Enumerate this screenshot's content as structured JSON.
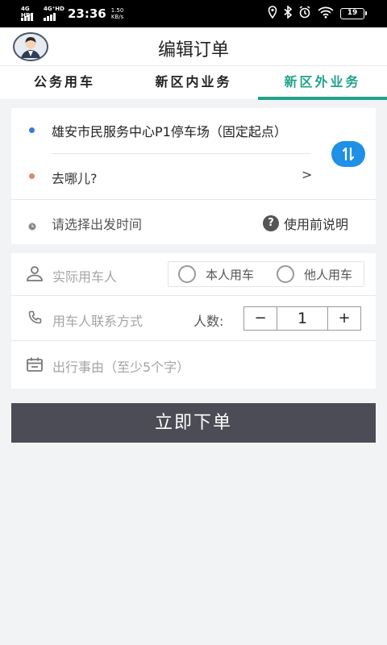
{
  "status_bar": {
    "network1": "4G HD",
    "network2": "4G⁺HD",
    "time": "23:36",
    "speed_value": "1.50",
    "speed_unit": "KB/s",
    "battery": "19"
  },
  "header": {
    "title": "编辑订单"
  },
  "tabs": [
    {
      "label": "公务用车",
      "active": false
    },
    {
      "label": "新区内业务",
      "active": false
    },
    {
      "label": "新区外业务",
      "active": true
    }
  ],
  "route": {
    "origin": "雄安市民服务中心P1停车场（固定起点）",
    "destination_placeholder": "去哪儿?",
    "destination_arrow": ">",
    "departure_time_placeholder": "请选择出发时间",
    "help_label": "使用前说明"
  },
  "passenger": {
    "name_placeholder": "实际用车人",
    "self_option": "本人用车",
    "other_option": "他人用车",
    "contact_placeholder": "用车人联系方式",
    "count_label": "人数:",
    "count_value": "1",
    "minus": "−",
    "plus": "+",
    "reason_placeholder": "出行事由（至少5个字）"
  },
  "submit_label": "立即下单",
  "colors": {
    "accent": "#21a38a",
    "swap_button": "#1e90e6",
    "origin_dot": "#3a78d8",
    "destination_dot": "#e0866a",
    "submit_bg": "#4b4c55",
    "page_bg": "#f2f3f5"
  },
  "icons": {
    "avatar": "user-avatar",
    "swap": "swap-vertical-icon",
    "time": "clock-icon",
    "help": "question-icon",
    "person": "person-icon",
    "phone": "phone-icon",
    "calendar": "calendar-icon"
  }
}
